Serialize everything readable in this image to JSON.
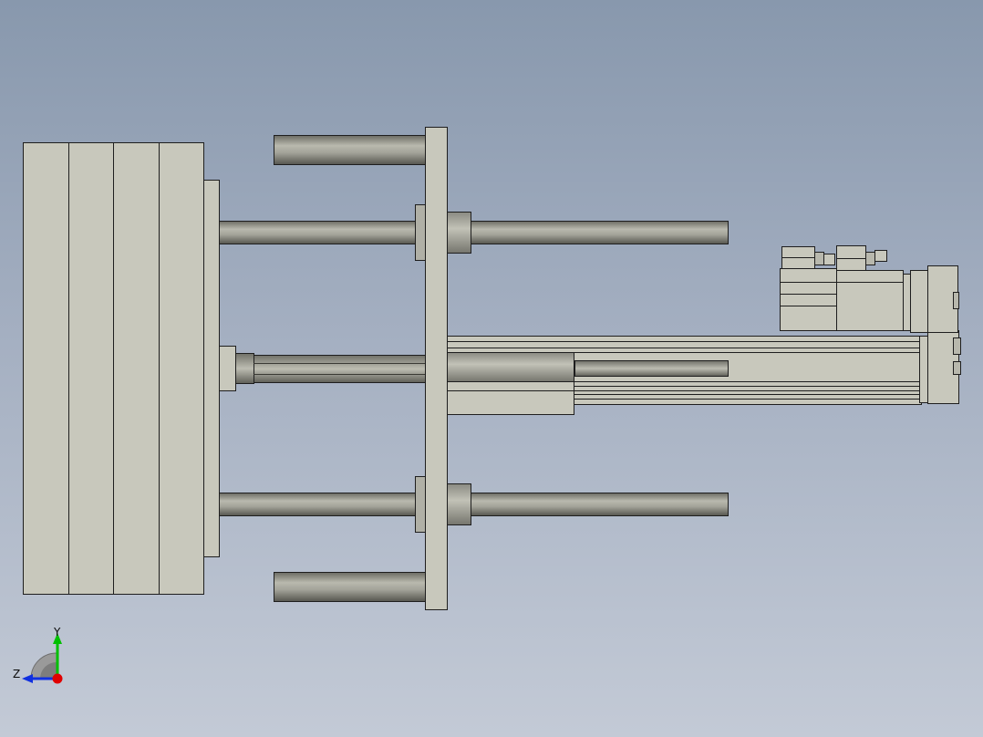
{
  "view": {
    "background_top": "#8898ad",
    "background_bottom": "#c3cad6",
    "part_fill": "#c8c8bc",
    "rod_color": "#9a9a90",
    "edge_color": "#1e1e1e"
  },
  "triad": {
    "y_label": "Y",
    "z_label": "Z",
    "y_color": "#00c000",
    "z_color": "#1030e0",
    "x_color": "#e00000"
  }
}
